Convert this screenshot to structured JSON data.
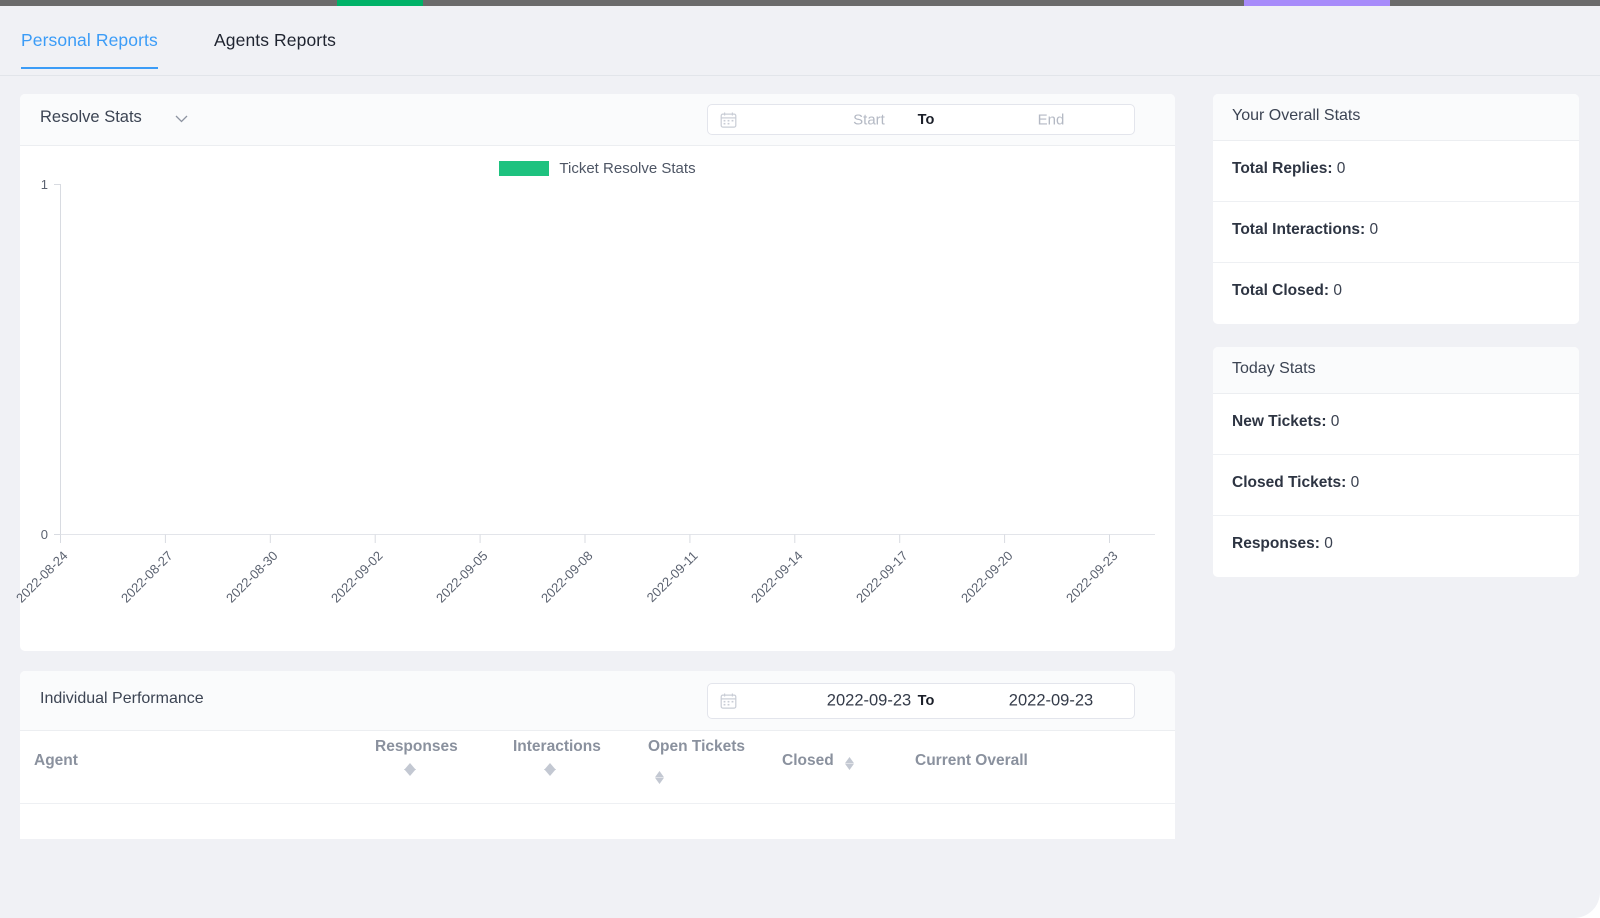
{
  "top_progress": {
    "green_color": "#00b268",
    "purple_color": "#a78bfa"
  },
  "tabs": [
    {
      "label": "Personal Reports",
      "active": true
    },
    {
      "label": "Agents Reports",
      "active": false
    }
  ],
  "resolve_stats": {
    "title": "Resolve Stats",
    "dropdown_icon": "chevron-down-icon",
    "date_range": {
      "calendar_icon": "calendar-icon",
      "start_placeholder": "Start",
      "separator": "To",
      "end_placeholder": "End",
      "start_value": "",
      "end_value": ""
    }
  },
  "chart_data": {
    "type": "line",
    "title": "",
    "legend": [
      {
        "name": "Ticket Resolve Stats",
        "color": "#1ec27f"
      }
    ],
    "legend_position": "top-center",
    "xlabel": "",
    "ylabel": "",
    "ylim": [
      0,
      1
    ],
    "yticks": [
      "0",
      "1"
    ],
    "grid": false,
    "x": [
      "2022-08-24",
      "2022-08-27",
      "2022-08-30",
      "2022-09-02",
      "2022-09-05",
      "2022-09-08",
      "2022-09-11",
      "2022-09-14",
      "2022-09-17",
      "2022-09-20",
      "2022-09-23"
    ],
    "series": [
      {
        "name": "Ticket Resolve Stats",
        "values": [
          0,
          0,
          0,
          0,
          0,
          0,
          0,
          0,
          0,
          0,
          0
        ]
      }
    ]
  },
  "overall_stats": {
    "heading": "Your Overall Stats",
    "rows": [
      {
        "label": "Total Replies:",
        "value": "0"
      },
      {
        "label": "Total Interactions:",
        "value": "0"
      },
      {
        "label": "Total Closed:",
        "value": "0"
      }
    ]
  },
  "today_stats": {
    "heading": "Today Stats",
    "rows": [
      {
        "label": "New Tickets:",
        "value": "0"
      },
      {
        "label": "Closed Tickets:",
        "value": "0"
      },
      {
        "label": "Responses:",
        "value": "0"
      }
    ]
  },
  "individual_performance": {
    "title": "Individual Performance",
    "date_range": {
      "calendar_icon": "calendar-icon",
      "start_value": "2022-09-23",
      "separator": "To",
      "end_value": "2022-09-23"
    },
    "columns": [
      {
        "label": "Agent",
        "sortable": false
      },
      {
        "label": "Responses",
        "sortable": true
      },
      {
        "label": "Interactions",
        "sortable": true
      },
      {
        "label": "Open Tickets",
        "sortable": true
      },
      {
        "label": "Closed",
        "sortable": true
      },
      {
        "label": "Current Overall",
        "sortable": false
      }
    ],
    "rows": []
  }
}
